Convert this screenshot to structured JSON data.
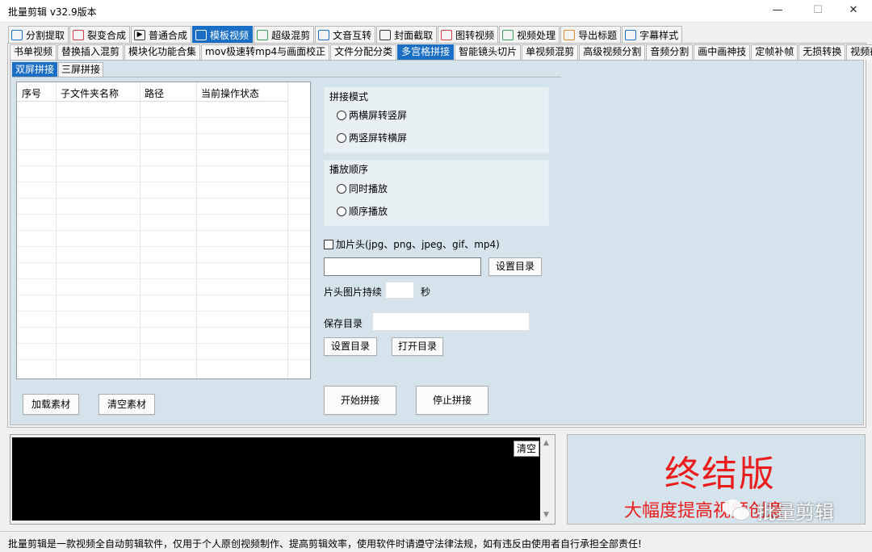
{
  "window": {
    "title": "批量剪辑   v32.9版本",
    "controls": {
      "minimize": "—",
      "maximize": "☐",
      "close": "✕"
    }
  },
  "main_tabs": [
    {
      "label": "分割提取",
      "icon": "blue-square-icon"
    },
    {
      "label": "裂变合成",
      "icon": "red-square-icon"
    },
    {
      "label": "普通合成",
      "icon": "play-icon"
    },
    {
      "label": "模板视频",
      "icon": "template-icon",
      "active": true
    },
    {
      "label": "超级混剪",
      "icon": "waveform-icon"
    },
    {
      "label": "文音互转",
      "icon": "microphone-icon"
    },
    {
      "label": "封面截取",
      "icon": "image-icon"
    },
    {
      "label": "图转视频",
      "icon": "image-to-video-icon"
    },
    {
      "label": "视频处理",
      "icon": "video-process-icon"
    },
    {
      "label": "导出标题",
      "icon": "export-title-icon"
    },
    {
      "label": "字幕样式",
      "icon": "subtitle-style-icon"
    }
  ],
  "sub_tabs": [
    {
      "label": "书单视频"
    },
    {
      "label": "替换插入混剪"
    },
    {
      "label": "模块化功能合集"
    },
    {
      "label": "mov极速转mp4与画面校正"
    },
    {
      "label": "文件分配分类"
    },
    {
      "label": "多宫格拼接",
      "active": true
    },
    {
      "label": "智能镜头切片"
    },
    {
      "label": "单视频混剪"
    },
    {
      "label": "高级视频分割"
    },
    {
      "label": "音频分割"
    },
    {
      "label": "画中画神技"
    },
    {
      "label": "定帧补帧"
    },
    {
      "label": "无损转换"
    },
    {
      "label": "视频截图"
    }
  ],
  "inner_tabs": [
    {
      "label": "双屏拼接",
      "active": true
    },
    {
      "label": "三屏拼接"
    }
  ],
  "table": {
    "columns": [
      "序号",
      "子文件夹名称",
      "路径",
      "当前操作状态"
    ]
  },
  "buttons": {
    "load": "加载素材",
    "clear_material": "清空素材",
    "set_dir_1": "设置目录",
    "set_dir_2": "设置目录",
    "open_dir": "打开目录",
    "start": "开始拼接",
    "stop": "停止拼接",
    "clear_log": "清空"
  },
  "splice_mode": {
    "legend": "拼接模式",
    "options": [
      "两横屏转竖屏",
      "两竖屏转横屏"
    ]
  },
  "play_order": {
    "legend": "播放顺序",
    "options": [
      "同时播放",
      "顺序播放"
    ]
  },
  "intro": {
    "checkbox_label": "加片头(jpg、png、jpeg、gif、mp4)",
    "path_value": "",
    "duration_label": "片头图片持续",
    "duration_value": "",
    "duration_unit": "秒"
  },
  "save": {
    "label": "保存目录",
    "value": ""
  },
  "promo": {
    "headline": "终结版",
    "subline": "大幅度提高视频创意"
  },
  "watermark": {
    "text": "批量剪辑",
    "icon": "wechat-icon"
  },
  "status_bar": "批量剪辑是一款视频全自动剪辑软件，仅用于个人原创视频制作、提高剪辑效率，使用软件时请遵守法律法规，如有违反由使用者自行承担全部责任!"
}
